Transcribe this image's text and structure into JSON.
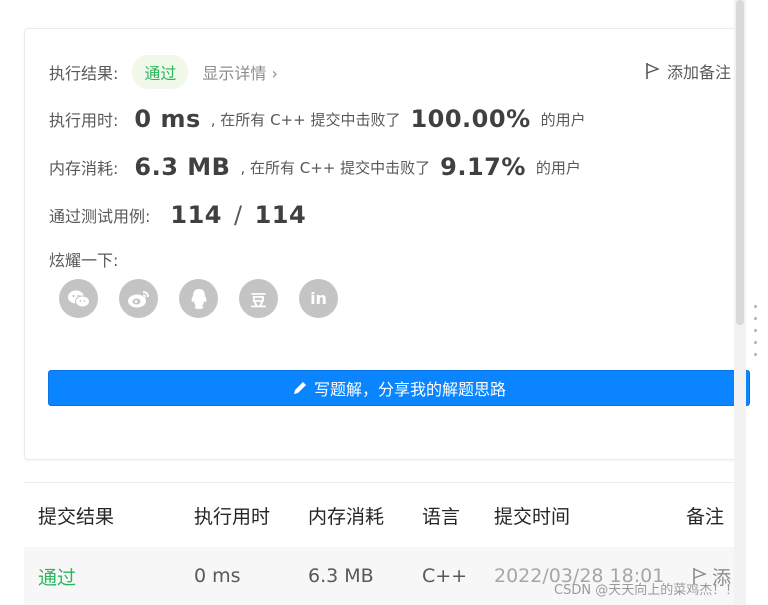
{
  "result": {
    "label": "执行结果:",
    "status": "通过",
    "detail": "显示详情",
    "detail_chevron": "›",
    "add_note": "添加备注"
  },
  "runtime": {
    "label": "执行用时:",
    "value": "0 ms",
    "beat_prefix": ", 在所有 C++ 提交中击败了",
    "percent": "100.00%",
    "suffix": "的用户"
  },
  "memory": {
    "label": "内存消耗:",
    "value": "6.3 MB",
    "beat_prefix": ", 在所有 C++ 提交中击败了",
    "percent": "9.17%",
    "suffix": "的用户"
  },
  "tests": {
    "label": "通过测试用例:",
    "passed": "114",
    "sep": "/",
    "total": "114"
  },
  "share": {
    "label": "炫耀一下:",
    "icons": [
      "wechat-icon",
      "weibo-icon",
      "qq-icon",
      "douban-icon",
      "linkedin-icon"
    ],
    "douban_text": "豆",
    "linkedin_text": "in"
  },
  "write_solution": {
    "label": "写题解，分享我的解题思路"
  },
  "table": {
    "headers": [
      "提交结果",
      "执行用时",
      "内存消耗",
      "语言",
      "提交时间",
      "备注"
    ],
    "rows": [
      {
        "result": "通过",
        "runtime": "0 ms",
        "memory": "6.3 MB",
        "lang": "C++",
        "time": "2022/03/28 18:01",
        "note_text": "添"
      }
    ]
  },
  "watermark": "CSDN @天天向上的菜鸡杰！！",
  "colors": {
    "accent": "#0a84ff",
    "pass": "#2db55d",
    "pill_bg": "#f0f8ea",
    "icon_gray": "#c4c4c4"
  }
}
